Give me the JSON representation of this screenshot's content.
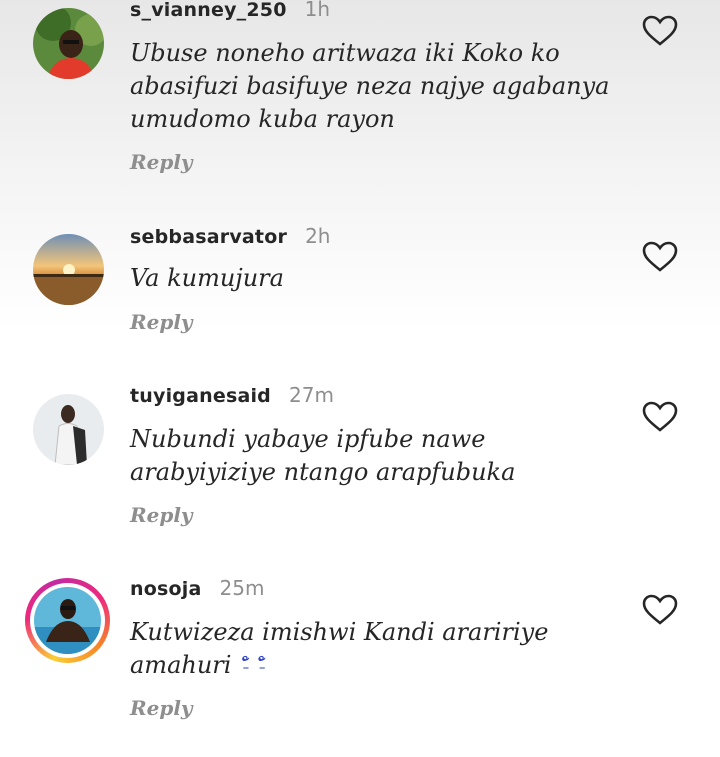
{
  "comments": [
    {
      "username": "s_vianney_250",
      "time": "1h",
      "text": "Ubuse noneho aritwaza iki Koko ko abasifuzi basifuye neza najye agabanya umudomo kuba rayon",
      "reply_label": "Reply"
    },
    {
      "username": "sebbasarvator",
      "time": "2h",
      "text": "Va kumujura",
      "reply_label": "Reply"
    },
    {
      "username": "tuyiganesaid",
      "time": "27m",
      "text": "Nubundi yabaye ipfube nawe arabyiyiziye ntango arapfubuka",
      "reply_label": "Reply"
    },
    {
      "username": "nosoja",
      "time": "25m",
      "text": "Kutwizeza imishwi Kandi araririye amahuri",
      "emoji": "˘̵̊ ˘̵̊",
      "reply_label": "Reply"
    }
  ],
  "colors": {
    "text": "#262626",
    "muted": "#8e8e8e",
    "emoji": "#2b3fc7"
  },
  "icons": [
    "heart-icon",
    "avatar"
  ]
}
